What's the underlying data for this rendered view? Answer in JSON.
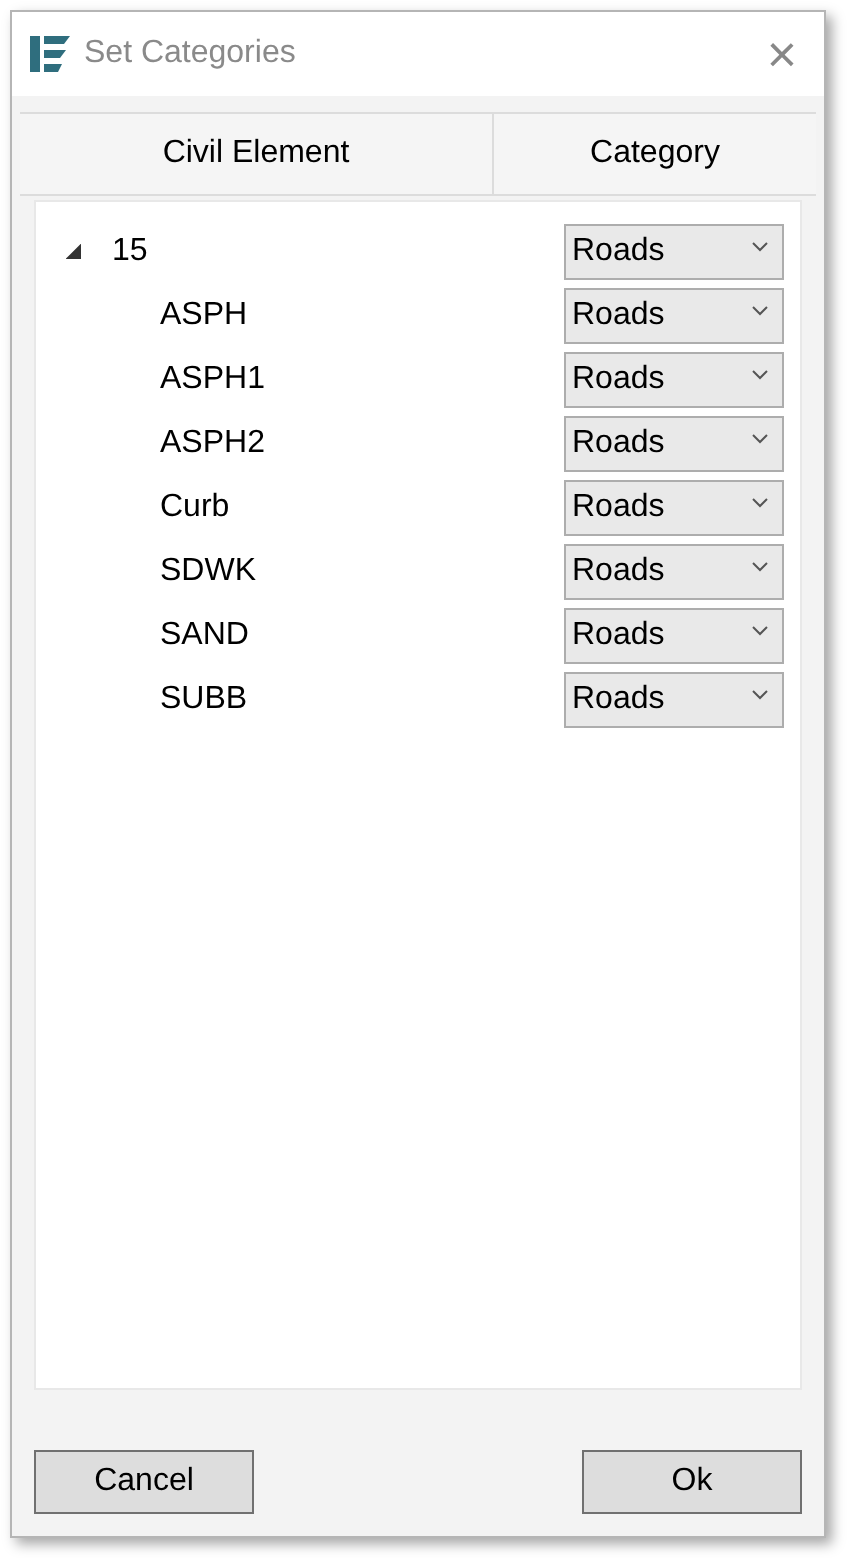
{
  "window": {
    "title": "Set Categories",
    "close": "×"
  },
  "columns": [
    "Civil Element",
    "Category"
  ],
  "tree": [
    {
      "label": "15",
      "category": "Roads",
      "expanded": true,
      "children": [
        {
          "label": "ASPH",
          "category": "Roads"
        },
        {
          "label": "ASPH1",
          "category": "Roads"
        },
        {
          "label": "ASPH2",
          "category": "Roads"
        },
        {
          "label": "Curb",
          "category": "Roads"
        },
        {
          "label": "SDWK",
          "category": "Roads"
        },
        {
          "label": "SAND",
          "category": "Roads"
        },
        {
          "label": "SUBB",
          "category": "Roads"
        }
      ]
    }
  ],
  "buttons": [
    "Cancel",
    "Ok"
  ]
}
